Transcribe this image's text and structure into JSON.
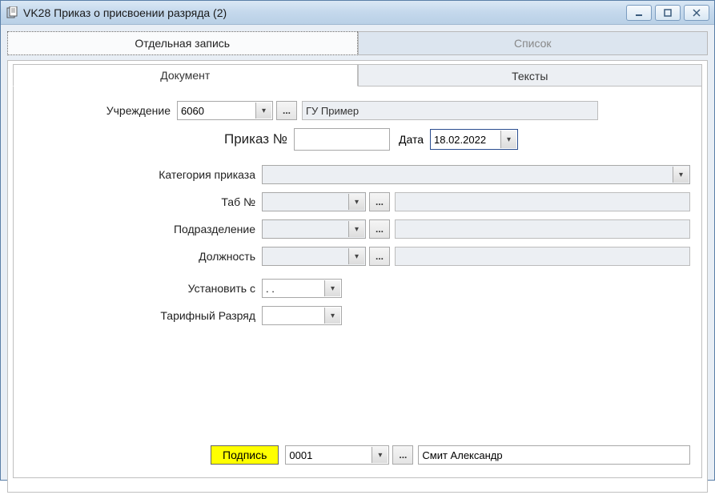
{
  "window": {
    "title": "VK28 Приказ о присвоении разряда (2)"
  },
  "topTabs": {
    "record": "Отдельная запись",
    "list": "Список"
  },
  "innerTabs": {
    "doc": "Документ",
    "texts": "Тексты"
  },
  "labels": {
    "institution": "Учреждение",
    "orderNo": "Приказ №",
    "date": "Дата",
    "orderCategory": "Категория приказа",
    "tabNo": "Таб №",
    "department": "Подразделение",
    "position": "Должность",
    "setFrom": "Установить с",
    "tariffGrade": "Тарифный Разряд"
  },
  "values": {
    "institutionCode": "6060",
    "institutionName": "ГУ Пример",
    "orderNo": "",
    "date": "18.02.2022",
    "orderCategory": "",
    "tabNo": "",
    "tabNoName": "",
    "department": "",
    "departmentName": "",
    "position": "",
    "positionName": "",
    "setFrom": " .  . ",
    "tariffGrade": ""
  },
  "signature": {
    "button": "Подпись",
    "code": "0001",
    "name": "Смит Александр"
  },
  "icons": {
    "ellipsis": "...",
    "caret": "▾"
  }
}
